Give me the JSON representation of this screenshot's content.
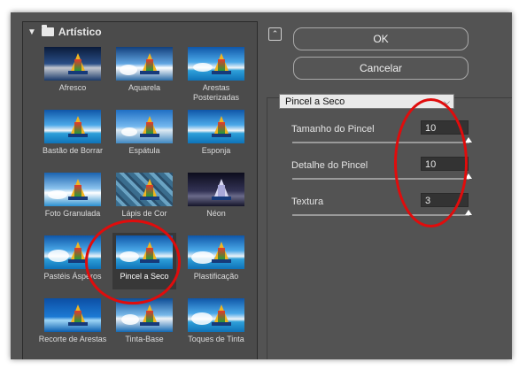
{
  "gallery": {
    "category": "Artístico",
    "filters": [
      "Afresco",
      "Aquarela",
      "Arestas Posterizadas",
      "Bastão de Borrar",
      "Espátula",
      "Esponja",
      "Foto Granulada",
      "Lápis de Cor",
      "Néon",
      "Pastéis Ásperos",
      "Pincel a Seco",
      "Plastificação",
      "Recorte de Arestas",
      "Tinta-Base",
      "Toques de Tinta"
    ],
    "selected": "Pincel a Seco"
  },
  "buttons": {
    "ok": "OK",
    "cancel": "Cancelar"
  },
  "panel": {
    "filter_select": "Pincel a Seco",
    "params": [
      {
        "label": "Tamanho do Pincel",
        "value": "10"
      },
      {
        "label": "Detalhe do Pincel",
        "value": "10"
      },
      {
        "label": "Textura",
        "value": "3"
      }
    ]
  },
  "annotation_color": "#e00c0c"
}
